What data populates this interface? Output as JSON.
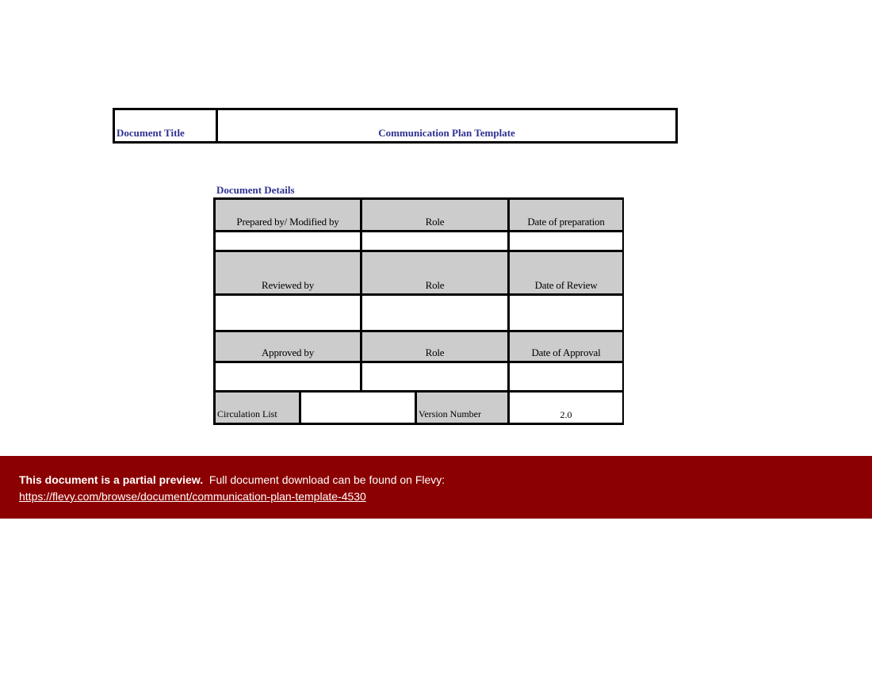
{
  "document": {
    "title_label": "Document Title",
    "title_value": "Communication Plan Template",
    "details_heading": "Document Details",
    "table": {
      "prepared": {
        "headers": [
          "Prepared by/ Modified by",
          "Role",
          "Date of preparation"
        ],
        "values": [
          "",
          "",
          ""
        ]
      },
      "reviewed": {
        "headers": [
          "Reviewed by",
          "Role",
          "Date of Review"
        ],
        "values": [
          "",
          "",
          ""
        ]
      },
      "approved": {
        "headers": [
          "Approved by",
          "Role",
          "Date of Approval"
        ],
        "values": [
          "",
          "",
          ""
        ]
      },
      "circulation_label": "Circulation List",
      "circulation_value": "",
      "version_label": "Version Number",
      "version_value": "2.0"
    }
  },
  "banner": {
    "bold_text": "This document is a partial preview.",
    "text": "Full document download can be found on Flevy:",
    "link": "https://flevy.com/browse/document/communication-plan-template-4530",
    "background": "#8b0000"
  }
}
